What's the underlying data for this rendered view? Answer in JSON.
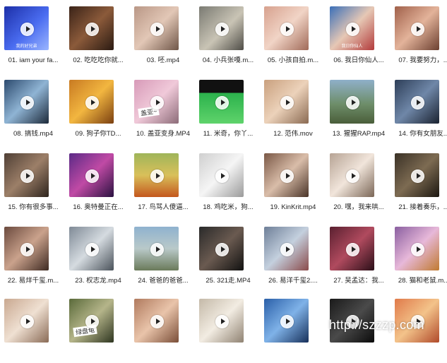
{
  "files": [
    {
      "name": "01. iam your fa...",
      "bg": "linear-gradient(135deg,#1c2fa8,#4a6cf0 55%,#9bb6ff)",
      "overlay": "我的好兄弟"
    },
    {
      "name": "02. 吃吃吃你就...",
      "bg": "linear-gradient(135deg,#3a2318,#8b5a3a 50%,#2a1a12)"
    },
    {
      "name": "03. 呸.mp4",
      "bg": "linear-gradient(135deg,#b99786,#e2c7b6 50%,#6f5648)"
    },
    {
      "name": "04. 小兵张嘎.m...",
      "bg": "linear-gradient(135deg,#7a7a72,#c9c4b5 55%,#4e4c46)"
    },
    {
      "name": "05. 小孩自拍.m...",
      "bg": "linear-gradient(135deg,#d7a18e,#f1d4c6 50%,#a06a58)"
    },
    {
      "name": "06. 我日你仙人...",
      "bg": "linear-gradient(135deg,#3a6fb8,#e6c8b5 50%,#b23a3a)",
      "overlay": "我日你仙人"
    },
    {
      "name": "07. 我要努力，...",
      "bg": "linear-gradient(135deg,#a0604a,#e3b39a 50%,#6b3f30)"
    },
    {
      "name": "08. 搞钱.mp4",
      "bg": "linear-gradient(135deg,#2c4a6e,#8fb4d4 50%,#1d2a3a)"
    },
    {
      "name": "09. 狗子你TD...",
      "bg": "linear-gradient(135deg,#c87a22,#f2b640 50%,#7a3f10)"
    },
    {
      "name": "10. 盖亚变身.MP4",
      "bg": "linear-gradient(135deg,#d79ab8,#f0c9d9 50%,#8c6c78)",
      "sticker": "盖亚~"
    },
    {
      "name": "11. 米奇，你丫...",
      "bg": "linear-gradient(180deg,#111 0 30%,#2bb24c 30%,#5fd36b 100%)"
    },
    {
      "name": "12. 范伟.mov",
      "bg": "linear-gradient(135deg,#c9a07e,#ecd2ba 50%,#8a6a52)"
    },
    {
      "name": "13. 猩猩RAP.mp4",
      "bg": "linear-gradient(180deg,#8fb0c9 0,#6e8e6a 55%,#4a5e3a 100%)"
    },
    {
      "name": "14. 你有女朋友...",
      "bg": "linear-gradient(135deg,#2d3e58,#6f87a8 50%,#1a2230)"
    },
    {
      "name": "15. 你有很多事...",
      "bg": "linear-gradient(135deg,#4f3f35,#9c7f68 50%,#2e241d)"
    },
    {
      "name": "16. 奥特曼正在...",
      "bg": "linear-gradient(135deg,#5b2a86,#c04aa5 50%,#2a1240)"
    },
    {
      "name": "17. 鸟骂人傻逼...",
      "bg": "linear-gradient(180deg,#9fb55a 0,#d9c05a 50%,#c4571d 100%)"
    },
    {
      "name": "18. 鸡吃米，狗...",
      "bg": "linear-gradient(135deg,#cfcfcf,#f5f5f5 50%,#9a9a9a)"
    },
    {
      "name": "19. KinKrit.mp4",
      "bg": "linear-gradient(135deg,#7a5846,#d9bda9 50%,#4a3428)"
    },
    {
      "name": "20. 嘿，我来哄...",
      "bg": "linear-gradient(135deg,#b6a394,#f1e5db 50%,#7a6656)"
    },
    {
      "name": "21. 接着奏乐，...",
      "bg": "linear-gradient(135deg,#3a3126,#7d6b52 50%,#1c1710)"
    },
    {
      "name": "22. 易烊千玺.m...",
      "bg": "linear-gradient(135deg,#6b4a3e,#caa28c 50%,#3e2a22)"
    },
    {
      "name": "23. 权志龙.mp4",
      "bg": "linear-gradient(135deg,#7f8a96,#d5dbe0 50%,#4a525a)"
    },
    {
      "name": "24. 爸爸的爸爸...",
      "bg": "linear-gradient(180deg,#8fb2cf 0,#b9c9c9 50%,#6a7a5a 100%)"
    },
    {
      "name": "25. 321走.MP4",
      "bg": "linear-gradient(135deg,#2a2a2a,#6a5a50 50%,#111)"
    },
    {
      "name": "26. 易洋千玺2....",
      "bg": "linear-gradient(135deg,#6e7f98,#c4d0de 50%,#8a4a4a)"
    },
    {
      "name": "27. 吴孟达：我...",
      "bg": "linear-gradient(135deg,#5a2030,#b04a5e 50%,#2a0f18)"
    },
    {
      "name": "28. 猫和老鼠.m...",
      "bg": "linear-gradient(135deg,#8a5fa0,#e7b8d9 50%,#c07a30)"
    },
    {
      "name": "",
      "bg": "linear-gradient(135deg,#c9a890,#efe0d2 50%,#8a6b56)"
    },
    {
      "name": "",
      "bg": "linear-gradient(135deg,#5a6a3a,#b5b58a 50%,#2e3520)",
      "sticker": "绿盘龟"
    },
    {
      "name": "",
      "bg": "linear-gradient(135deg,#b07a5e,#e9c4aa 50%,#7a4e38)"
    },
    {
      "name": "",
      "bg": "linear-gradient(135deg,#c4b9a8,#f2ece2 50%,#8f8272)"
    },
    {
      "name": "",
      "bg": "linear-gradient(135deg,#2a5fa8,#7fb2e8 50%,#17305a)"
    },
    {
      "name": "",
      "bg": "linear-gradient(135deg,#1a1a1a,#4a4a4a 50%,#0a0a0a)"
    },
    {
      "name": "",
      "bg": "linear-gradient(135deg,#e07a4a,#f3c38a 50%,#b04a2a)"
    }
  ],
  "watermark": "http://szzzp.com"
}
